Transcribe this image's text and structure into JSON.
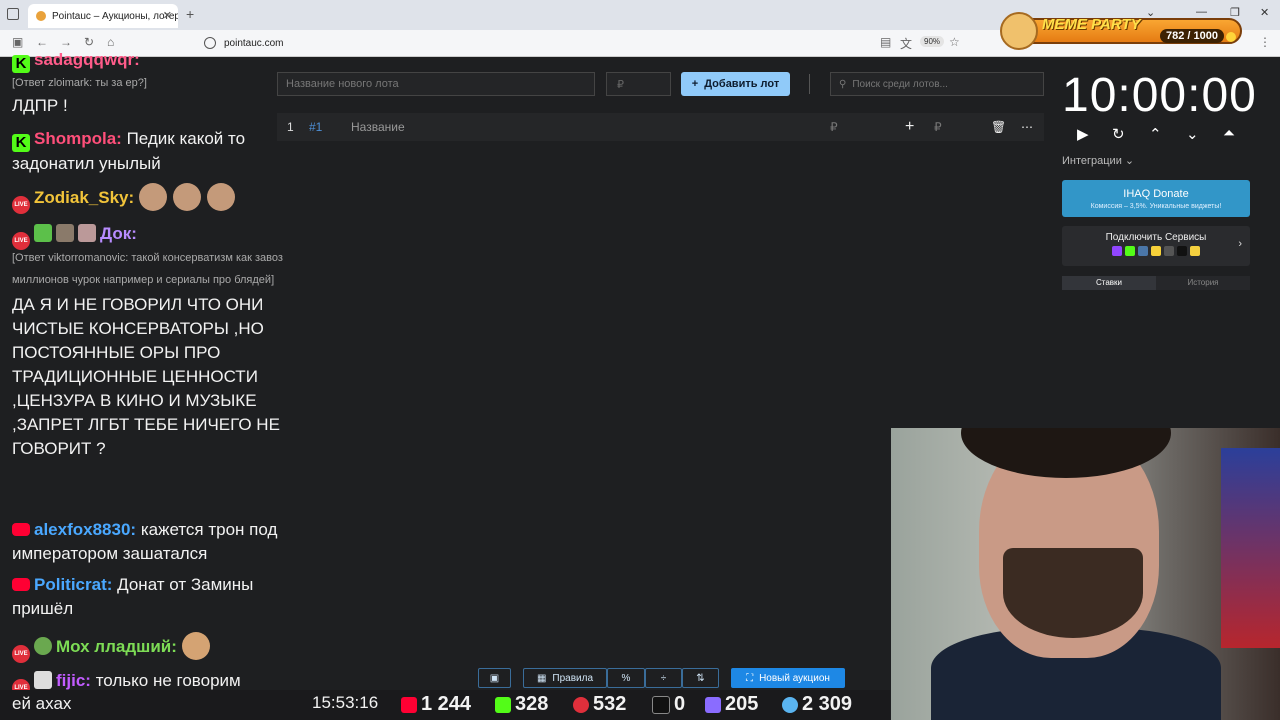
{
  "browser": {
    "tab_title": "Pointauc – Аукционы, лотереи",
    "url": "pointauc.com",
    "zoom": "90%"
  },
  "overlay": {
    "meme_title": "MEME PARTY",
    "meme_score": "782 / 1000"
  },
  "chat": {
    "messages": [
      {
        "nick": "sadagqqwqr:",
        "text": "",
        "nick_color": "#ff5c8a"
      },
      {
        "reply": "[Ответ zloimark: ты за ер?]",
        "text": "ЛДПР !"
      },
      {
        "nick": "Shompola:",
        "text": "Педик какой то задонатил унылый",
        "nick_color": "#ff4f7a"
      },
      {
        "nick": "Zodiak_Sky:",
        "text": "",
        "nick_color": "#f2c43a"
      },
      {
        "nick": "Док:",
        "text": "",
        "nick_color": "#b88cff"
      },
      {
        "reply": "[Ответ viktorromanovic: такой консерватизм как завоз миллионов чурок например и сериалы про блядей]",
        "text": "ДА Я И НЕ ГОВОРИЛ ЧТО ОНИ ЧИСТЫЕ КОНСЕРВАТОРЫ ,НО ПОСТОЯННЫЕ ОРЫ ПРО ТРАДИЦИОННЫЕ ЦЕННОСТИ ,ЦЕНЗУРА В КИНО И МУЗЫКЕ ,ЗАПРЕТ ЛГБТ ТЕБЕ НИЧЕГО НЕ ГОВОРИТ ?"
      },
      {
        "nick": "alexfox8830:",
        "text": "кажется трон под императором зашатался",
        "nick_color": "#4aa8ff"
      },
      {
        "nick": "Politicrat:",
        "text": "Донат от Замины пришёл",
        "nick_color": "#4aa8ff"
      },
      {
        "nick": "Мох лладший:",
        "text": "",
        "nick_color": "#7ddc55"
      },
      {
        "nick": "fijic:",
        "text": "только не говорим",
        "nick_color": "#c25cff"
      }
    ],
    "ticker_text": "ей ахах"
  },
  "stats": {
    "time": "15:53:16",
    "youtube": "1 244",
    "kick": "328",
    "live": "532",
    "r": "0",
    "other": "205",
    "viewers": "2 309"
  },
  "toolbar": {
    "lot_name_placeholder": "Название нового лота",
    "amount_placeholder": "₽",
    "add_label": "Добавить лот",
    "search_placeholder": "Поиск среди лотов..."
  },
  "lot_row": {
    "index": "1",
    "id": "#1",
    "name_placeholder": "Название",
    "currency": "₽",
    "add_currency": "₽"
  },
  "panel": {
    "timer": "10:00:00",
    "integrations_label": "Интеграции",
    "donate_title": "IHAQ Donate",
    "donate_sub": "Комиссия – 3,5%. Уникальные виджеты!",
    "services_title": "Подключить Сервисы",
    "tab_bets": "Ставки",
    "tab_history": "История"
  },
  "bottom": {
    "rules_label": "Правила",
    "new_auction_label": "Новый аукцион"
  },
  "colors": {
    "accent": "#90caf9",
    "primary": "#1e88e5",
    "donate": "#3296c8"
  }
}
